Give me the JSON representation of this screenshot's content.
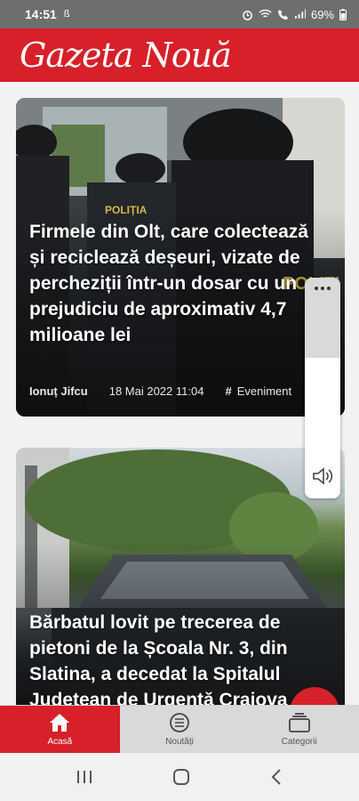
{
  "status_bar": {
    "time": "14:51",
    "battery": "69%"
  },
  "header": {
    "logo_text": "Gazeta Nouă"
  },
  "articles": [
    {
      "title": "Firmele din Olt, care colectează și reciclează deșeuri, vizate de percheziții într-un dosar cu un prejudiciu de aproximativ 4,7 milioane lei",
      "author": "Ionuț Jifcu",
      "date": "18 Mai 2022 11:04",
      "category": "Eveniment"
    },
    {
      "title": "Bărbatul lovit pe trecerea de pietoni de la Școala Nr. 3, din Slatina, a decedat la Spitalul Județean de Urgență Craiova"
    }
  ],
  "bottom_nav": {
    "home": "Acasă",
    "news": "Noutăți",
    "categories": "Categorii"
  },
  "colors": {
    "brand_red": "#d7202a",
    "nav_inactive": "#d9d9d9",
    "status_bar": "#6e6e6e"
  }
}
